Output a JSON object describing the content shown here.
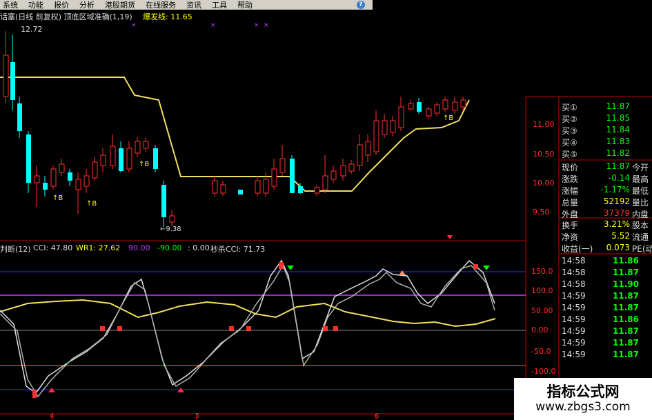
{
  "menu": {
    "items": [
      "系统",
      "功能",
      "报价",
      "分析",
      "港股期货",
      "在线服务",
      "资讯",
      "工具",
      "帮助"
    ]
  },
  "help_icon": "help-icon",
  "main_header": {
    "title": "话塞(日线 前复权) 顶底区域准确(1,19)",
    "burst_label": "爆发线: 11.65",
    "high_mark": "12.72",
    "low_mark": "←9.38",
    "buy_marks": [
      "↑B",
      "↑B",
      "↑B",
      "↑B"
    ]
  },
  "indicator_header": {
    "name": "判断(12)",
    "cci": "CCI: 47.80",
    "wr1": "WR1: 27.62",
    "v90": "90.00",
    "vneg90": "-90.00",
    "v0": ": 0.00",
    "miaosha": "秒杀CCI: 71.73"
  },
  "price_axis": [
    "11.00",
    "10.50",
    "10.00",
    "9.50"
  ],
  "indicator_axis": [
    "150.0",
    "100.0",
    "50.00",
    "0.00",
    "-50.0",
    "-100.0"
  ],
  "order_book": [
    {
      "label": "买①",
      "value": "11.87"
    },
    {
      "label": "买②",
      "value": "11.85"
    },
    {
      "label": "买③",
      "value": "11.84"
    },
    {
      "label": "买④",
      "value": "11.83"
    },
    {
      "label": "买⑤",
      "value": "11.82"
    }
  ],
  "stats": [
    {
      "label": "现价",
      "value": "11.87",
      "label2": "今开",
      "color": "#00ff00"
    },
    {
      "label": "涨跌",
      "value": "-0.14",
      "label2": "最高",
      "color": "#00ff00"
    },
    {
      "label": "涨幅",
      "value": "-1.17%",
      "label2": "最低",
      "color": "#00ff00"
    },
    {
      "label": "总量",
      "value": "52192",
      "label2": "量比",
      "color": "#ffff00"
    },
    {
      "label": "外盘",
      "value": "37379",
      "label2": "内盘",
      "color": "#ff3030"
    },
    {
      "label": "换手",
      "value": "3.21%",
      "label2": "股本",
      "color": "#ffff00"
    },
    {
      "label": "净资",
      "value": "5.52",
      "label2": "流通",
      "color": "#ffff00"
    },
    {
      "label": "收益(一)",
      "value": "0.073",
      "label2": "PE(动",
      "color": "#ffff00"
    }
  ],
  "ticks": [
    {
      "time": "14:58",
      "price": "11.86"
    },
    {
      "time": "14:58",
      "price": "11.87"
    },
    {
      "time": "14:58",
      "price": "11.90"
    },
    {
      "time": "14:59",
      "price": "11.87"
    },
    {
      "time": "14:59",
      "price": "11.87"
    },
    {
      "time": "14:59",
      "price": "11.86"
    },
    {
      "time": "14:59",
      "price": "11.87"
    },
    {
      "time": "14:59",
      "price": "11.87"
    },
    {
      "time": "14:59",
      "price": "11.87"
    }
  ],
  "date_axis": [
    "4",
    "5",
    "6"
  ],
  "watermark": {
    "cn": "指标公式网",
    "en": "www.zbgs3.com"
  },
  "colors": {
    "up": "#ff3030",
    "down": "#00ffff",
    "ma": "#ffff00",
    "bg": "#000000"
  }
}
